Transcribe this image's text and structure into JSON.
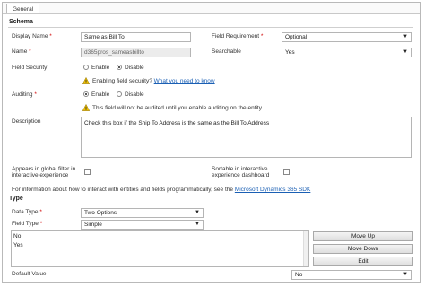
{
  "tab": {
    "general": "General"
  },
  "schema": {
    "title": "Schema",
    "display_name": {
      "label": "Display Name",
      "value": "Same as Bill To"
    },
    "name": {
      "label": "Name",
      "value": "d365pros_sameasbillto"
    },
    "field_requirement": {
      "label": "Field Requirement",
      "value": "Optional"
    },
    "searchable": {
      "label": "Searchable",
      "value": "Yes"
    },
    "field_security": {
      "label": "Field Security",
      "enable": "Enable",
      "disable": "Disable",
      "selected": "Disable"
    },
    "field_security_note": {
      "text": "Enabling field security?",
      "link": "What you need to know"
    },
    "auditing": {
      "label": "Auditing",
      "enable": "Enable",
      "disable": "Disable",
      "selected": "Enable"
    },
    "auditing_note": "This field will not be audited until you enable auditing on the entity.",
    "description": {
      "label": "Description",
      "value": "Check this box if the Ship To Address is the same as the Bill To Address"
    },
    "global_filter": {
      "label_line1": "Appears in global filter in",
      "label_line2": "interactive experience"
    },
    "sortable": {
      "label_line1": "Sortable in interactive",
      "label_line2": "experience dashboard"
    },
    "info": {
      "text": "For information about how to interact with entities and fields programmatically, see the",
      "link": "Microsoft Dynamics 365 SDK"
    }
  },
  "type": {
    "title": "Type",
    "data_type": {
      "label": "Data Type",
      "value": "Two Options"
    },
    "field_type": {
      "label": "Field Type",
      "value": "Simple"
    },
    "options": [
      "No",
      "Yes"
    ],
    "buttons": {
      "move_up": "Move Up",
      "move_down": "Move Down",
      "edit": "Edit"
    },
    "default_value": {
      "label": "Default Value",
      "value": "No"
    }
  },
  "required_mark": "*",
  "colors": {
    "required": "#d00000",
    "link": "#1a5fb4",
    "warning": "#f2c200"
  }
}
